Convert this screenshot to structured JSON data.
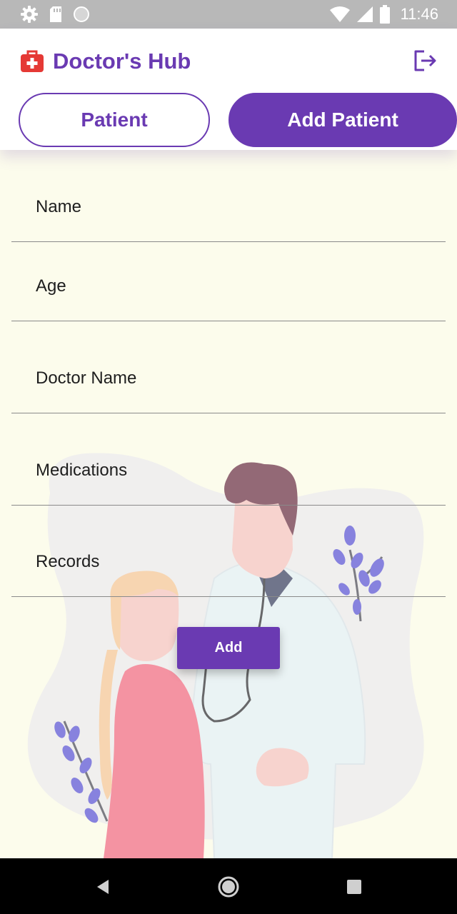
{
  "status_bar": {
    "time": "11:46",
    "icons": [
      "settings-icon",
      "sd-card-icon",
      "sync-circle-icon",
      "wifi-icon",
      "signal-icon",
      "battery-icon"
    ]
  },
  "header": {
    "title": "Doctor's Hub",
    "logo_icon": "first-aid-kit-icon",
    "logout_icon": "logout-icon",
    "brand_color": "#6a3ab2",
    "logo_color": "#e53935"
  },
  "tabs": [
    {
      "label": "Patient",
      "active": false
    },
    {
      "label": "Add Patient",
      "active": true
    }
  ],
  "form": {
    "fields": [
      {
        "placeholder": "Name",
        "value": ""
      },
      {
        "placeholder": "Age",
        "value": ""
      },
      {
        "placeholder": "Doctor Name",
        "value": ""
      },
      {
        "placeholder": "Medications",
        "value": ""
      },
      {
        "placeholder": "Records",
        "value": ""
      }
    ],
    "submit_label": "Add"
  },
  "nav_bar": {
    "icons": [
      "back-triangle-icon",
      "home-circle-icon",
      "recents-square-icon"
    ]
  },
  "colors": {
    "accent": "#6a3ab2",
    "page_background": "#fdfdec",
    "status_bar": "#b8b8b8",
    "nav_bar": "#000000"
  }
}
